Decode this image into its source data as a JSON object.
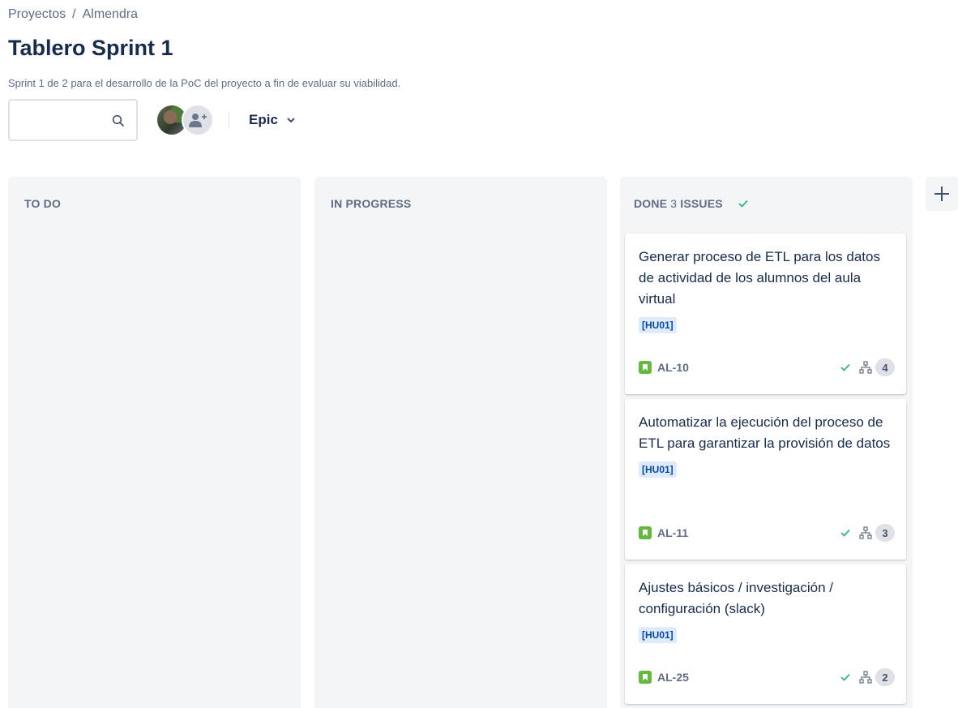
{
  "breadcrumb": {
    "items": [
      "Proyectos",
      "Almendra"
    ],
    "separator": "/"
  },
  "page": {
    "title": "Tablero Sprint 1",
    "description": "Sprint 1 de 2 para el desarrollo de la PoC del proyecto a fin de evaluar su viabilidad."
  },
  "toolbar": {
    "search_value": "",
    "search_placeholder": "",
    "epic_label": "Epic"
  },
  "columns": [
    {
      "title": "TO DO",
      "count": "",
      "count_suffix": ""
    },
    {
      "title": "IN PROGRESS",
      "count": "",
      "count_suffix": ""
    },
    {
      "title": "DONE",
      "count": "3",
      "count_suffix": "ISSUES"
    }
  ],
  "cards": [
    {
      "title": "Generar proceso de ETL para los datos de actividad de los alumnos del aula virtual",
      "epic": "[HU01]",
      "key": "AL-10",
      "subtasks": "4"
    },
    {
      "title": "Automatizar la ejecución del proceso de ETL para garantizar la provisión de datos",
      "epic": "[HU01]",
      "key": "AL-11",
      "subtasks": "3"
    },
    {
      "title": "Ajustes básicos / investigación / configuración (slack)",
      "epic": "[HU01]",
      "key": "AL-25",
      "subtasks": "2"
    }
  ],
  "icons": {
    "search": "search-icon",
    "add_user": "add-user-icon",
    "chevron": "chevron-down-icon",
    "done_check": "check-icon",
    "story": "story-icon",
    "subtasks": "subtask-icon",
    "add_column": "plus-icon"
  },
  "colors": {
    "done_green": "#36b37e",
    "story_green": "#63ba3c",
    "epic_bg": "#deebff",
    "epic_text": "#0747a6"
  }
}
